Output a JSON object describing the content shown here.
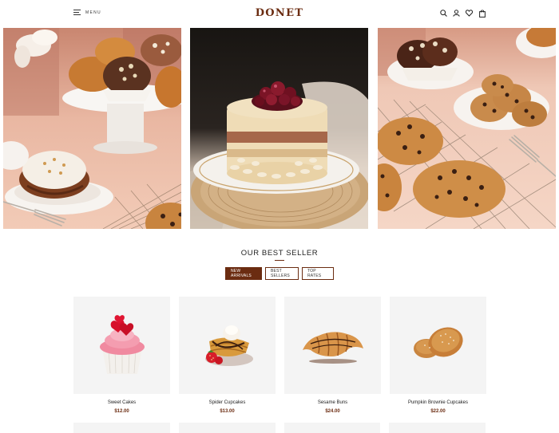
{
  "header": {
    "menu_label": "MENU",
    "logo": "DONET",
    "icons": [
      "search-icon",
      "user-icon",
      "heart-icon",
      "bag-icon"
    ]
  },
  "hero": {
    "panels": [
      "pastries-panel",
      "cheesecake-panel",
      "cookies-panel"
    ]
  },
  "best_seller": {
    "title": "OUR BEST SELLER",
    "tabs": [
      {
        "label": "NEW ARRIVALS",
        "active": true
      },
      {
        "label": "BEST SELLERS",
        "active": false
      },
      {
        "label": "TOP RATES",
        "active": false
      }
    ]
  },
  "products": [
    {
      "name": "Sweet Cakes",
      "price": "$12.00"
    },
    {
      "name": "Spider Cupcakes",
      "price": "$13.00"
    },
    {
      "name": "Sesame Buns",
      "price": "$24.00"
    },
    {
      "name": "Pumpkin Brownie Cupcakes",
      "price": "$22.00"
    }
  ],
  "colors": {
    "accent": "#6b2c11",
    "card_bg": "#f4f4f4"
  }
}
